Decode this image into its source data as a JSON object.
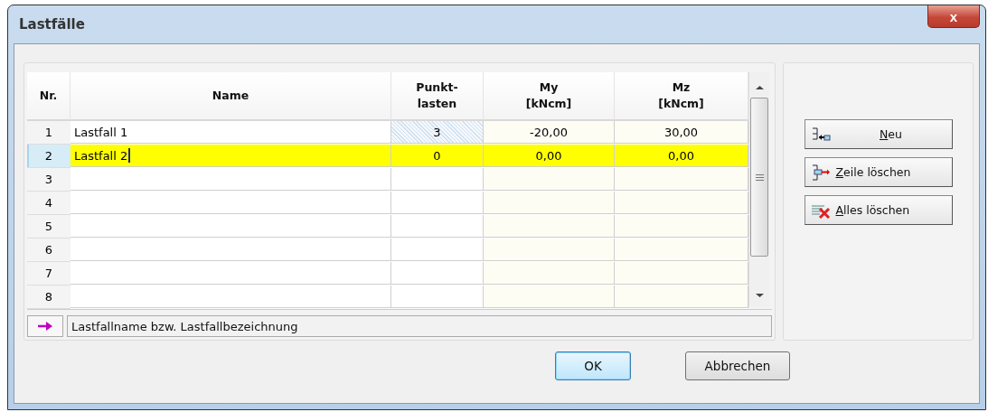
{
  "window": {
    "title": "Lastfälle",
    "close_symbol": "x"
  },
  "table": {
    "columns": [
      {
        "label": "Nr."
      },
      {
        "label": "Name",
        "readonly": false
      },
      {
        "label": "Punkt-\nlasten",
        "readonly": false
      },
      {
        "label": "My\n[kNcm]",
        "readonly": true
      },
      {
        "label": "Mz\n[kNcm]",
        "readonly": true
      }
    ],
    "rows": [
      {
        "cells": [
          "1",
          "Lastfall 1",
          "3",
          "-20,00",
          "30,00"
        ],
        "selected": false,
        "editing": false,
        "punkt_marked": true
      },
      {
        "cells": [
          "2",
          "Lastfall 2",
          "0",
          "0,00",
          "0,00"
        ],
        "selected": true,
        "editing": true,
        "punkt_marked": false
      },
      {
        "cells": [
          "3"
        ],
        "selected": false,
        "editing": false,
        "punkt_marked": false
      },
      {
        "cells": [
          "4"
        ],
        "selected": false,
        "editing": false,
        "punkt_marked": false
      },
      {
        "cells": [
          "5"
        ],
        "selected": false,
        "editing": false,
        "punkt_marked": false
      },
      {
        "cells": [
          "6"
        ],
        "selected": false,
        "editing": false,
        "punkt_marked": false
      },
      {
        "cells": [
          "7"
        ],
        "selected": false,
        "editing": false,
        "punkt_marked": false
      },
      {
        "cells": [
          "8"
        ],
        "selected": false,
        "editing": false,
        "punkt_marked": false
      }
    ]
  },
  "hint": {
    "text": "Lastfallname bzw. Lastfallbezeichnung"
  },
  "side_buttons": [
    {
      "kind": "new",
      "label": "Neu",
      "mnemonic_first": true
    },
    {
      "kind": "delete-row",
      "label": "Zeile löschen",
      "mnemonic_first": true
    },
    {
      "kind": "delete-all",
      "label": "Alles löschen",
      "mnemonic_first": true
    }
  ],
  "buttons": [
    {
      "label": "OK",
      "default": true
    },
    {
      "label": "Abbrechen",
      "default": false
    }
  ]
}
